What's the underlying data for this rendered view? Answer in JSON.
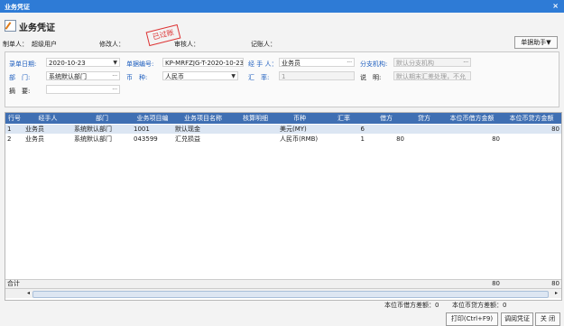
{
  "window": {
    "title": "业务凭证",
    "close": "×"
  },
  "header": {
    "title": "业务凭证",
    "stamp": "已过账"
  },
  "info": {
    "maker_label": "制单人：",
    "maker_value": "超级用户",
    "modifier_label": "修改人：",
    "auditor_label": "审核人：",
    "bookkeeper_label": "记账人：",
    "help_button": "单据助手▼"
  },
  "form": {
    "entry_date": {
      "label": "录单日期:",
      "value": "2020-10-23"
    },
    "doc_no": {
      "label": "单据编号:",
      "value": "KP-MRFZJG-T-2020-10-23"
    },
    "handler": {
      "label": "经 手 人：",
      "value": "业务员"
    },
    "branch": {
      "label": "分支机构:",
      "placeholder": "默认分支机构"
    },
    "dept": {
      "label": "部　门:",
      "value": "系统默认部门"
    },
    "currency": {
      "label": "币　种:",
      "value": "人民币"
    },
    "rate": {
      "label": "汇　率:",
      "value": "1"
    },
    "note": {
      "label": "说　明:",
      "value": "默认期末汇差处理，不允"
    },
    "summary": {
      "label": "摘　要:",
      "value": ""
    }
  },
  "grid": {
    "columns": [
      "行号",
      "经手人",
      "部门",
      "业务项目编",
      "业务项目名称",
      "核算明细",
      "币种",
      "汇率",
      "借方",
      "贷方",
      "本位币借方金额",
      "本位币贷方金额"
    ],
    "rows": [
      [
        "1",
        "业务员",
        "系统默认部门",
        "1001",
        "默认现金",
        "",
        "美元(MY)",
        "6",
        "",
        "",
        "",
        "80"
      ],
      [
        "2",
        "业务员",
        "系统默认部门",
        "043599",
        "汇兑损益",
        "",
        "人民币(RMB)",
        "1",
        "80",
        "",
        "80",
        ""
      ]
    ],
    "totals": {
      "label": "合计",
      "debit": "80",
      "credit": "80"
    }
  },
  "footer": {
    "debit_diff": "本位币借方差额：0",
    "credit_diff": "本位币贷方差额：0",
    "print_button": "打印(Ctrl+F9)",
    "retrieve_button": "调阅凭证",
    "close_button": "关 闭"
  }
}
